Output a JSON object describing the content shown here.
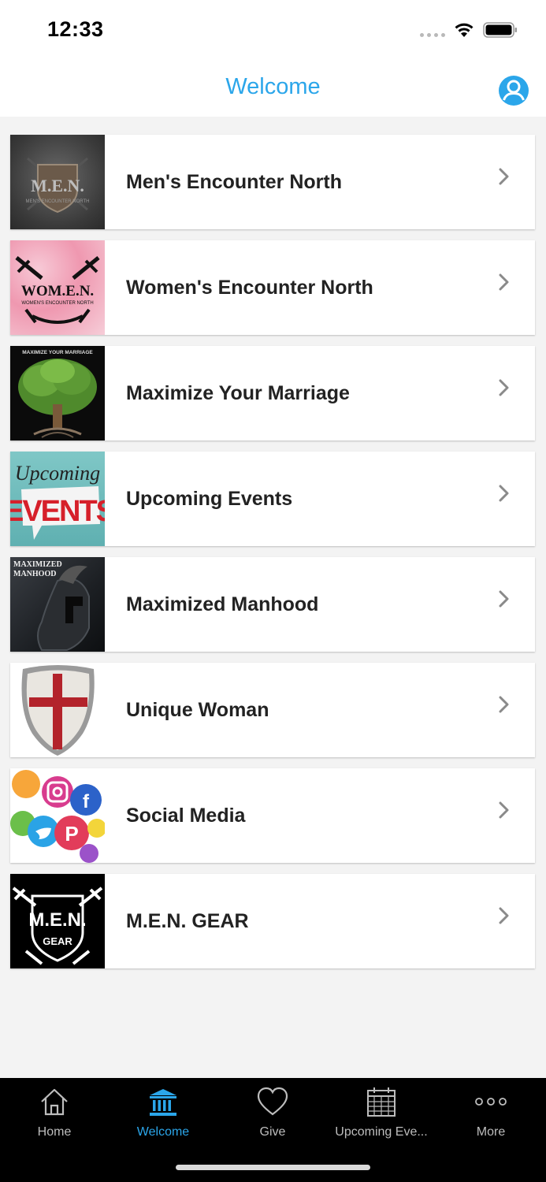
{
  "status": {
    "time": "12:33"
  },
  "header": {
    "title": "Welcome",
    "profile_icon": "person-circle-icon",
    "accent": "#2ba6ea"
  },
  "items": [
    {
      "label": "Men's Encounter North",
      "thumb_text": "M.E.N.",
      "thumb_sub": "MEN'S ENCOUNTER NORTH"
    },
    {
      "label": "Women's Encounter North",
      "thumb_text": "WOM.E.N.",
      "thumb_sub": "WOMEN'S ENCOUNTER NORTH"
    },
    {
      "label": "Maximize Your Marriage",
      "thumb_text": "MAXIMIZE YOUR MARRIAGE"
    },
    {
      "label": "Upcoming Events",
      "thumb_text": "Upcoming",
      "thumb_sub": "EVENTS"
    },
    {
      "label": "Maximized Manhood",
      "thumb_text": "MAXIMIZED",
      "thumb_sub": "MANHOOD"
    },
    {
      "label": "Unique Woman"
    },
    {
      "label": "Social Media"
    },
    {
      "label": "M.E.N. GEAR",
      "thumb_text": "M.E.N.",
      "thumb_sub": "GEAR"
    }
  ],
  "tabs": [
    {
      "label": "Home",
      "icon": "house-icon",
      "active": false
    },
    {
      "label": "Welcome",
      "icon": "bank-icon",
      "active": true
    },
    {
      "label": "Give",
      "icon": "heart-icon",
      "active": false
    },
    {
      "label": "Upcoming Eve...",
      "icon": "calendar-icon",
      "active": false
    },
    {
      "label": "More",
      "icon": "more-dots-icon",
      "active": false
    }
  ]
}
